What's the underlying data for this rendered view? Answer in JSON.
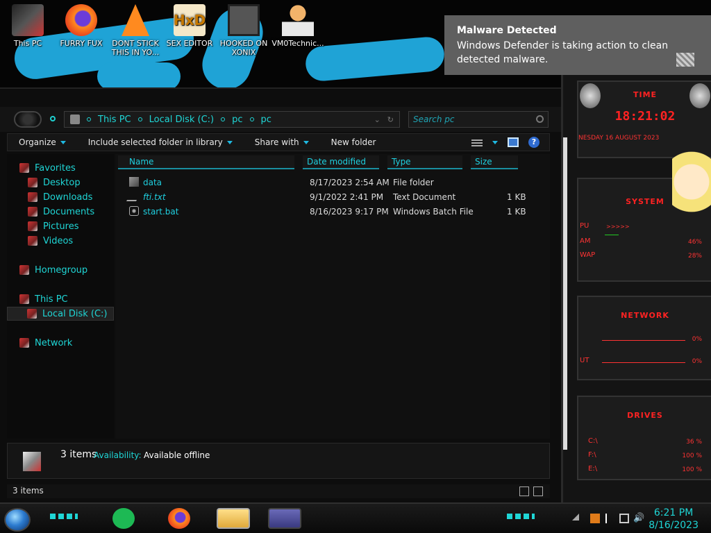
{
  "desktop": {
    "icons": [
      {
        "label": "This PC"
      },
      {
        "label": "FURRY FUX"
      },
      {
        "label": "DONT STICK THIS IN YO..."
      },
      {
        "label": "SEX EDITOR"
      },
      {
        "label": "HOOKED ON XONIX"
      },
      {
        "label": "VM0Technic..."
      }
    ]
  },
  "notification": {
    "title": "Malware Detected",
    "body": "Windows Defender is taking action to clean detected malware."
  },
  "explorer": {
    "breadcrumb": [
      "This PC",
      "Local Disk (C:)",
      "pc",
      "pc"
    ],
    "search_placeholder": "Search pc",
    "toolbar": {
      "organize": "Organize",
      "include": "Include selected folder in library",
      "share": "Share with",
      "new_folder": "New folder"
    },
    "nav": {
      "favorites": "Favorites",
      "desktop": "Desktop",
      "downloads": "Downloads",
      "documents": "Documents",
      "pictures": "Pictures",
      "videos": "Videos",
      "homegroup": "Homegroup",
      "thispc": "This PC",
      "localdisk": "Local Disk (C:)",
      "network": "Network"
    },
    "columns": {
      "name": "Name",
      "date": "Date modified",
      "type": "Type",
      "size": "Size"
    },
    "files": [
      {
        "name": "data",
        "date": "8/17/2023 2:54 AM",
        "type": "File folder",
        "size": ""
      },
      {
        "name": "fti.txt",
        "date": "9/1/2022 2:41 PM",
        "type": "Text Document",
        "size": "1 KB"
      },
      {
        "name": "start.bat",
        "date": "8/16/2023 9:17 PM",
        "type": "Windows Batch File",
        "size": "1 KB"
      }
    ],
    "details": {
      "count": "3 items",
      "availability_label": "Availability:",
      "availability_value": "Available offline"
    },
    "status": "3 items"
  },
  "gadget": {
    "time_title": "TIME",
    "time": "18:21:02",
    "date": "NESDAY 16 AUGUST 2023",
    "system_title": "SYSTEM",
    "pu_label": "PU",
    "am_label": "AM",
    "am_value": "46%",
    "wap_label": "WAP",
    "wap_value": "28%",
    "network_title": "NETWORK",
    "net_in_value": "0%",
    "net_out_label": "UT",
    "net_out_value": "0%",
    "drives_title": "DRIVES",
    "drives": [
      {
        "label": "C:\\",
        "value": "36 %"
      },
      {
        "label": "F:\\",
        "value": "100 %"
      },
      {
        "label": "E:\\",
        "value": "100 %"
      }
    ]
  },
  "taskbar": {
    "time": "6:21 PM",
    "date": "8/16/2023"
  }
}
